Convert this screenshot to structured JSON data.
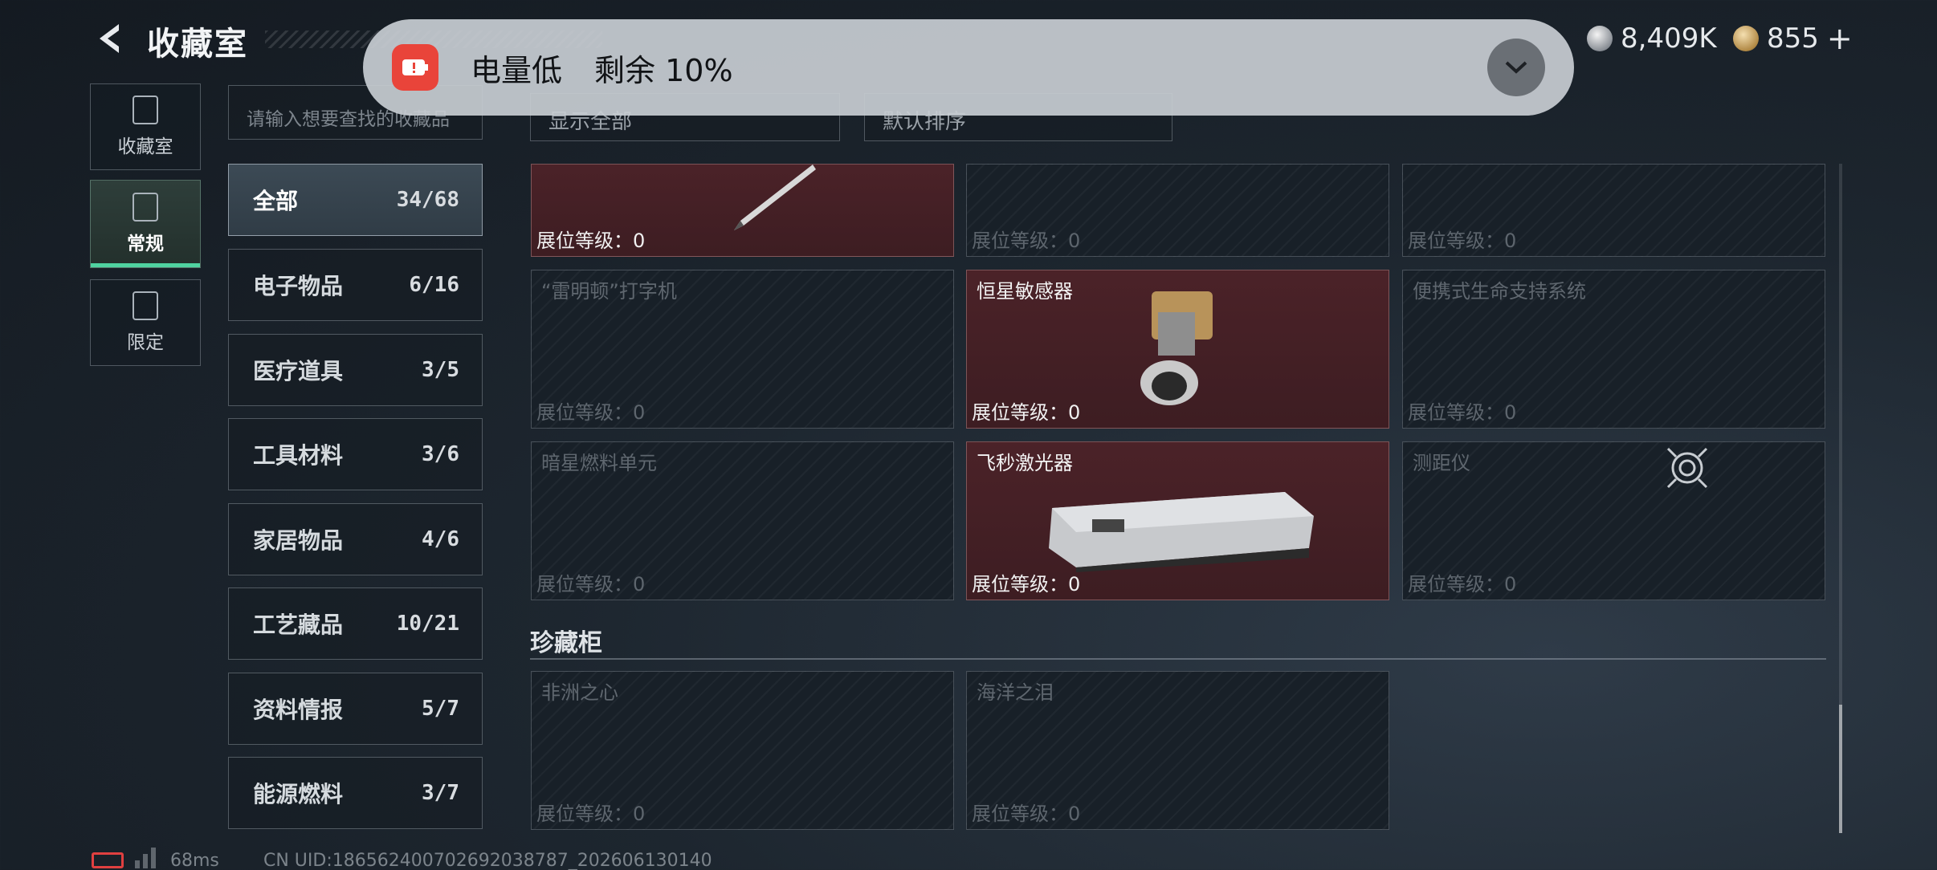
{
  "header": {
    "title": "收藏室"
  },
  "currency": {
    "silver": "8,409K",
    "gold": "855"
  },
  "notification": {
    "title": "电量低",
    "detail": "剩余 10%"
  },
  "left_nav": [
    {
      "label": "收藏室"
    },
    {
      "label": "常规"
    },
    {
      "label": "限定"
    }
  ],
  "search": {
    "placeholder": "请输入想要查找的收藏品"
  },
  "filters": {
    "display": "显示全部",
    "sort": "默认排序"
  },
  "categories": [
    {
      "label": "全部",
      "count": "34/68"
    },
    {
      "label": "电子物品",
      "count": "6/16"
    },
    {
      "label": "医疗道具",
      "count": "3/5"
    },
    {
      "label": "工具材料",
      "count": "3/6"
    },
    {
      "label": "家居物品",
      "count": "4/6"
    },
    {
      "label": "工艺藏品",
      "count": "10/21"
    },
    {
      "label": "资料情报",
      "count": "5/7"
    },
    {
      "label": "能源燃料",
      "count": "3/7"
    }
  ],
  "level_label": "展位等级：0",
  "items": [
    {
      "name": ""
    },
    {
      "name": ""
    },
    {
      "name": ""
    },
    {
      "name": "“雷明顿”打字机"
    },
    {
      "name": "恒星敏感器"
    },
    {
      "name": "便携式生命支持系统"
    },
    {
      "name": "暗星燃料单元"
    },
    {
      "name": "飞秒激光器"
    },
    {
      "name": "测距仪"
    }
  ],
  "section": {
    "title": "珍藏柜"
  },
  "cabinet": [
    {
      "name": "非洲之心"
    },
    {
      "name": "海洋之泪"
    }
  ],
  "footer": {
    "ping": "68ms",
    "uid": "CN UID:1865624007026920387​87_202606130140"
  },
  "colors": {
    "owned": "#4b2228",
    "accent": "#4fd3a0",
    "alert": "#e9443a"
  }
}
